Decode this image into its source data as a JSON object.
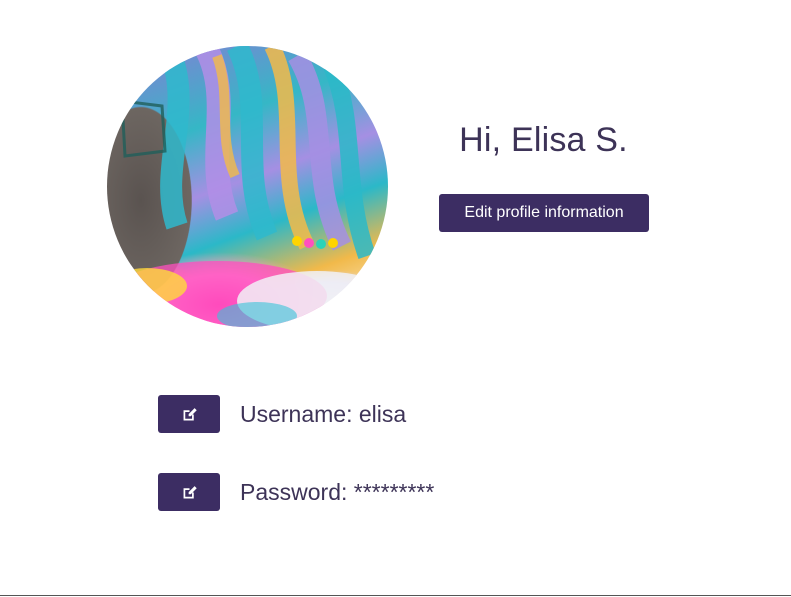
{
  "profile": {
    "greeting": "Hi, Elisa S.",
    "edit_button_label": "Edit profile information",
    "avatar_alt": "profile photo with rainbow hair"
  },
  "fields": {
    "username": {
      "label": "Username: elisa",
      "icon": "edit-icon"
    },
    "password": {
      "label": "Password: *********",
      "icon": "edit-icon"
    }
  },
  "colors": {
    "accent": "#3c2d63",
    "text": "#3d3357",
    "background": "#ffffff"
  }
}
